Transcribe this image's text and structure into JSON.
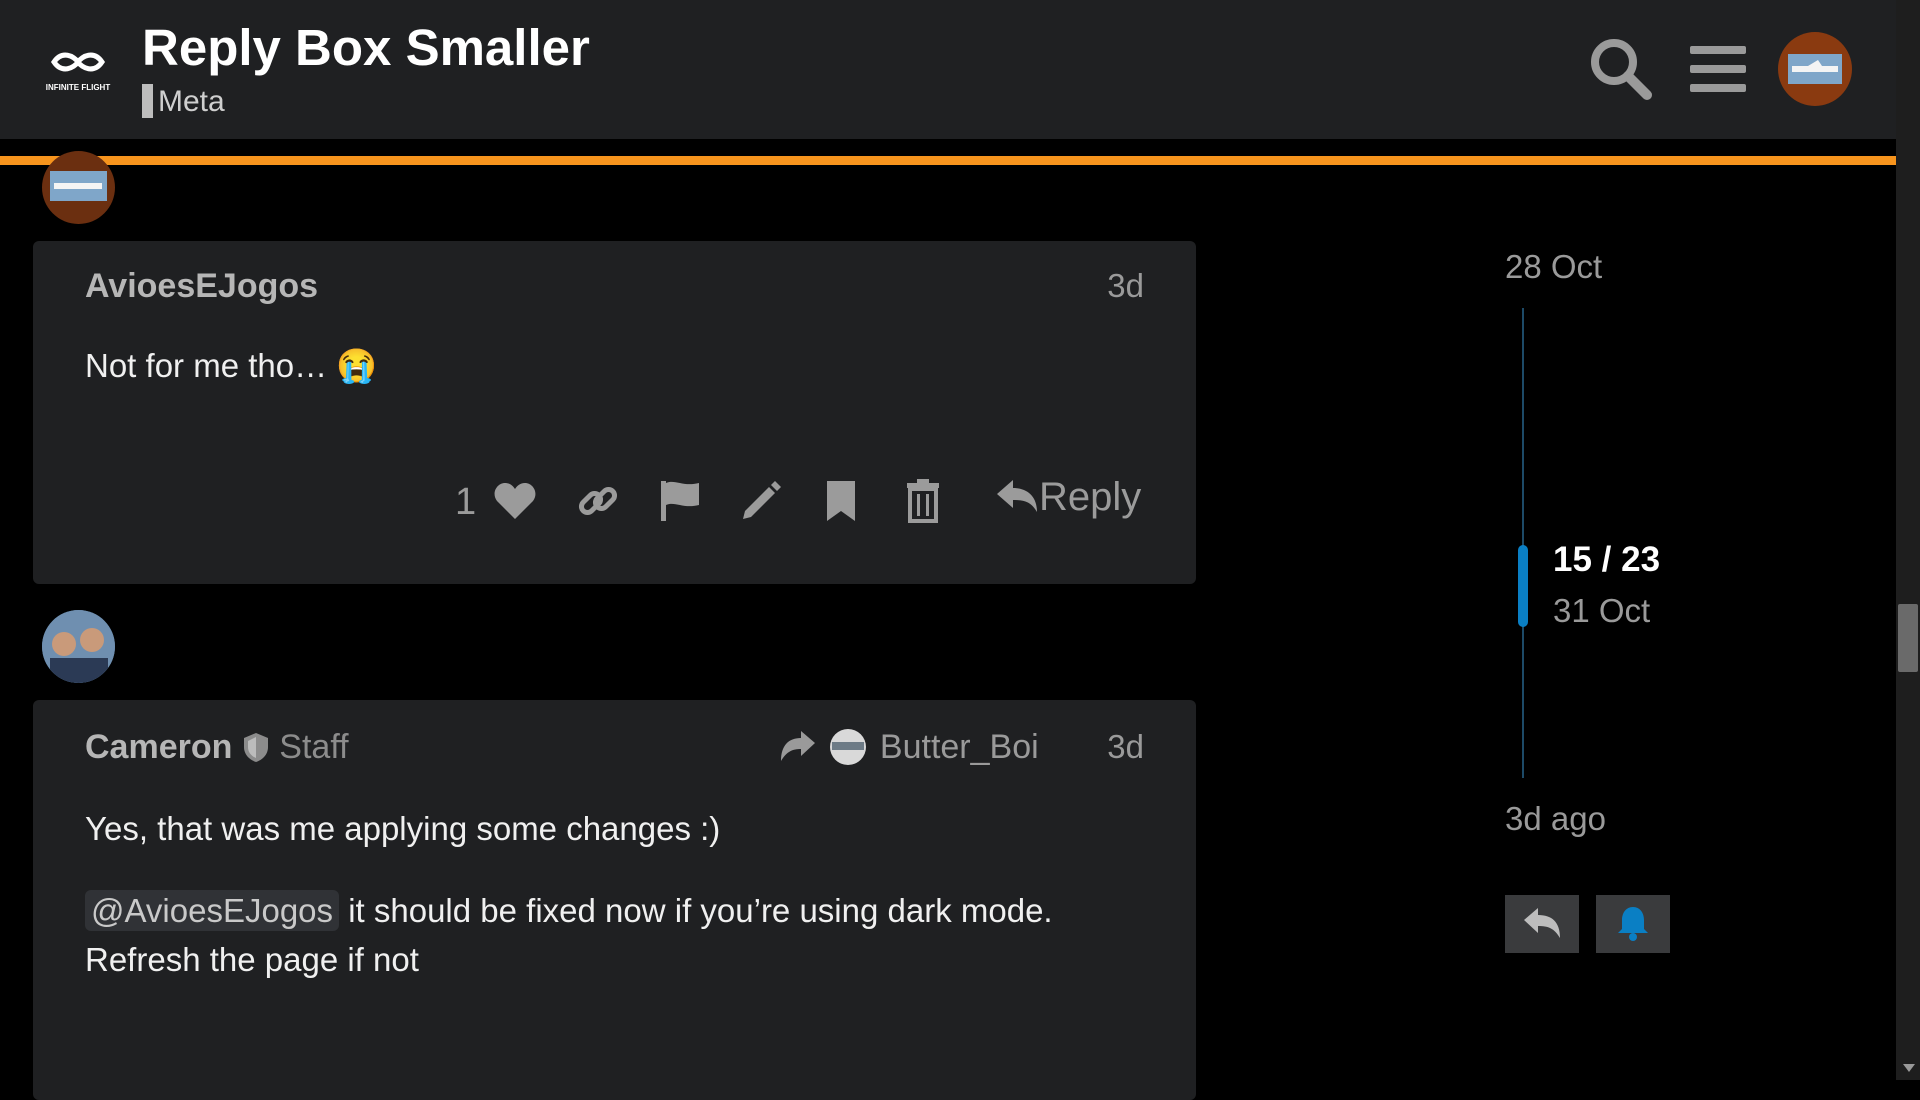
{
  "header": {
    "logo_text": "INFINITE FLIGHT",
    "title": "Reply Box Smaller",
    "category": "Meta"
  },
  "icons": {
    "search": "search-icon",
    "menu": "hamburger-menu-icon",
    "user_avatar": "user-avatar"
  },
  "colors": {
    "accent": "#f7941d",
    "timeline": "#0a7fc4",
    "post_bg": "#1f2022",
    "page_bg": "#000000"
  },
  "posts": [
    {
      "username": "AvioesEJogos",
      "date": "3d",
      "body": "Not for me tho… 😭",
      "like_count": "1",
      "reply_label": "Reply"
    },
    {
      "username": "Cameron",
      "role": "Staff",
      "reply_to": "Butter_Boi",
      "date": "3d",
      "paragraph1": "Yes, that was me applying some changes :)",
      "mention": "@AvioesEJogos",
      "paragraph2_rest": " it should be fixed now if you’re using dark mode. Refresh the page if not"
    }
  ],
  "timeline": {
    "start_date": "28 Oct",
    "position": "15 / 23",
    "current_date": "31 Oct",
    "end_date": "3d ago"
  }
}
